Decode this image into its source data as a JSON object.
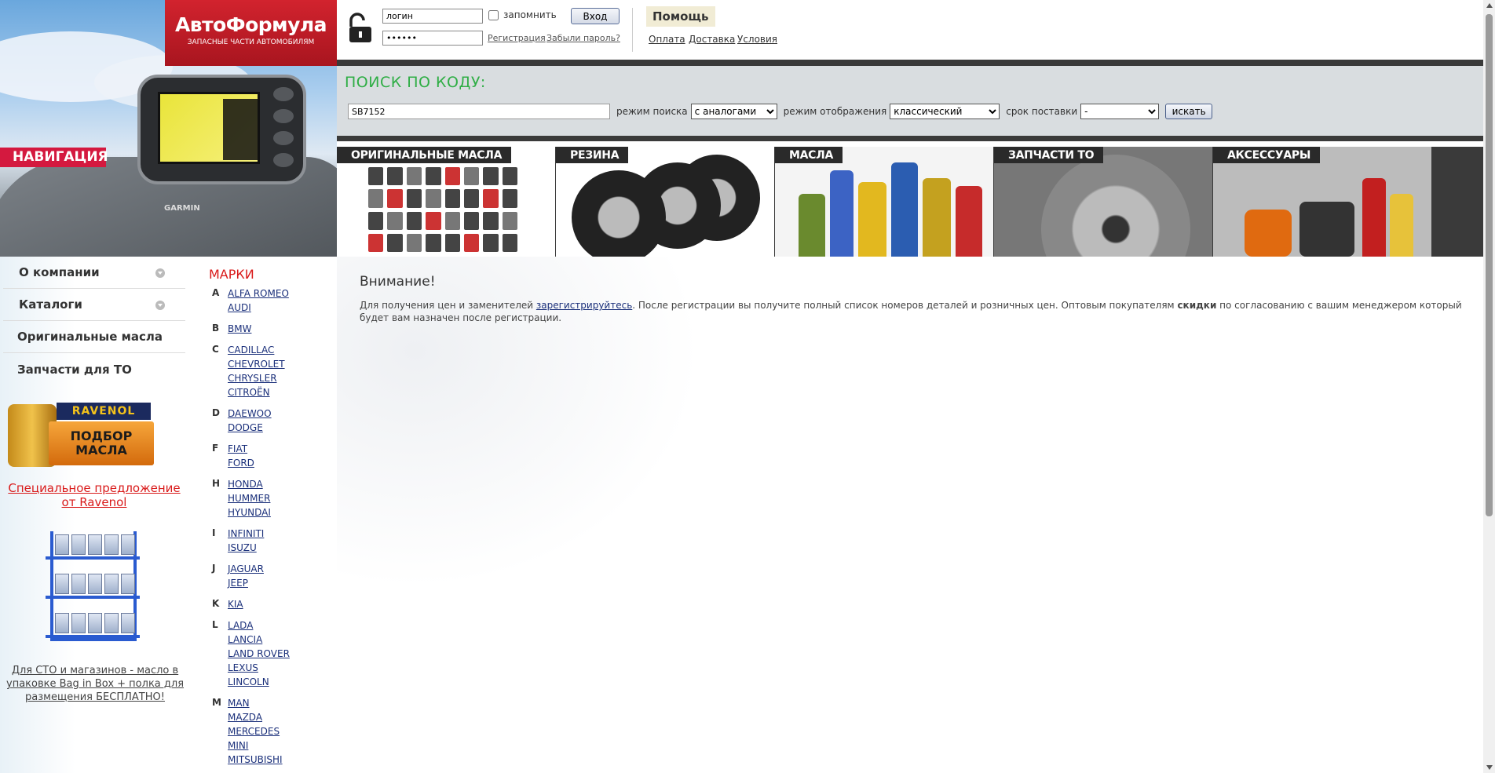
{
  "header": {
    "logo_name": "АвтоФормула",
    "logo_tagline": "ЗАПАСНЫЕ ЧАСТИ АВТОМОБИЛЯМ",
    "section_label": "НАВИГАЦИЯ",
    "gps_brand": "GARMIN"
  },
  "login": {
    "username_value": "логин",
    "password_value": "••••••",
    "remember_label": "запомнить",
    "login_button": "Вход",
    "register_link": "Регистрация",
    "forgot_link": "Забыли пароль?",
    "help_label": "Помощь",
    "links": [
      "Оплата",
      "Доставка",
      "Условия"
    ]
  },
  "search": {
    "title": "ПОИСК ПО КОДУ:",
    "query": "SB7152",
    "mode_label": "режим поиска",
    "mode_value": "с аналогами",
    "display_label": "режим отображения",
    "display_value": "классический",
    "delivery_label": "срок поставки",
    "delivery_value": "-",
    "button": "искать"
  },
  "tiles": [
    "ОРИГИНАЛЬНЫЕ МАСЛА",
    "РЕЗИНА",
    "МАСЛА",
    "ЗАПЧАСТИ ТО",
    "АКСЕССУАРЫ"
  ],
  "sidebar": {
    "menu": [
      "О компании",
      "Каталоги",
      "Оригинальные масла",
      "Запчасти для ТО"
    ],
    "ravenol_brand": "RAVENOL",
    "ravenol_pick": "ПОДБОР МАСЛА",
    "special_offer": "Специальное предложение от Ravenol",
    "sto_text": "Для СТО и магазинов - масло в упаковке Bag in Box + полка для размещения БЕСПЛАТНО!"
  },
  "brands": {
    "title": "МАРКИ",
    "groups": [
      {
        "letter": "A",
        "items": [
          "ALFA ROMEO",
          "AUDI"
        ]
      },
      {
        "letter": "B",
        "items": [
          "BMW"
        ]
      },
      {
        "letter": "C",
        "items": [
          "CADILLAC",
          "CHEVROLET",
          "CHRYSLER",
          "CITROËN"
        ]
      },
      {
        "letter": "D",
        "items": [
          "DAEWOO",
          "DODGE"
        ]
      },
      {
        "letter": "F",
        "items": [
          "FIAT",
          "FORD"
        ]
      },
      {
        "letter": "H",
        "items": [
          "HONDA",
          "HUMMER",
          "HYUNDAI"
        ]
      },
      {
        "letter": "I",
        "items": [
          "INFINITI",
          "ISUZU"
        ]
      },
      {
        "letter": "J",
        "items": [
          "JAGUAR",
          "JEEP"
        ]
      },
      {
        "letter": "K",
        "items": [
          "KIA"
        ]
      },
      {
        "letter": "L",
        "items": [
          "LADA",
          "LANCIA",
          "LAND ROVER",
          "LEXUS",
          "LINCOLN"
        ]
      },
      {
        "letter": "M",
        "items": [
          "MAN",
          "MAZDA",
          "MERCEDES",
          "MINI",
          "MITSUBISHI"
        ]
      }
    ]
  },
  "content": {
    "title": "Внимание!",
    "text_1": "Для получения цен и заменителей ",
    "register_link": "зарегистрируйтесь",
    "text_2": ". После регистрации вы получите полный список номеров деталей и розничных цен. Оптовым покупателям ",
    "bold_word": "скидки",
    "text_3": " по согласованию с вашим менеджером который будет вам назначен после регистрации."
  }
}
